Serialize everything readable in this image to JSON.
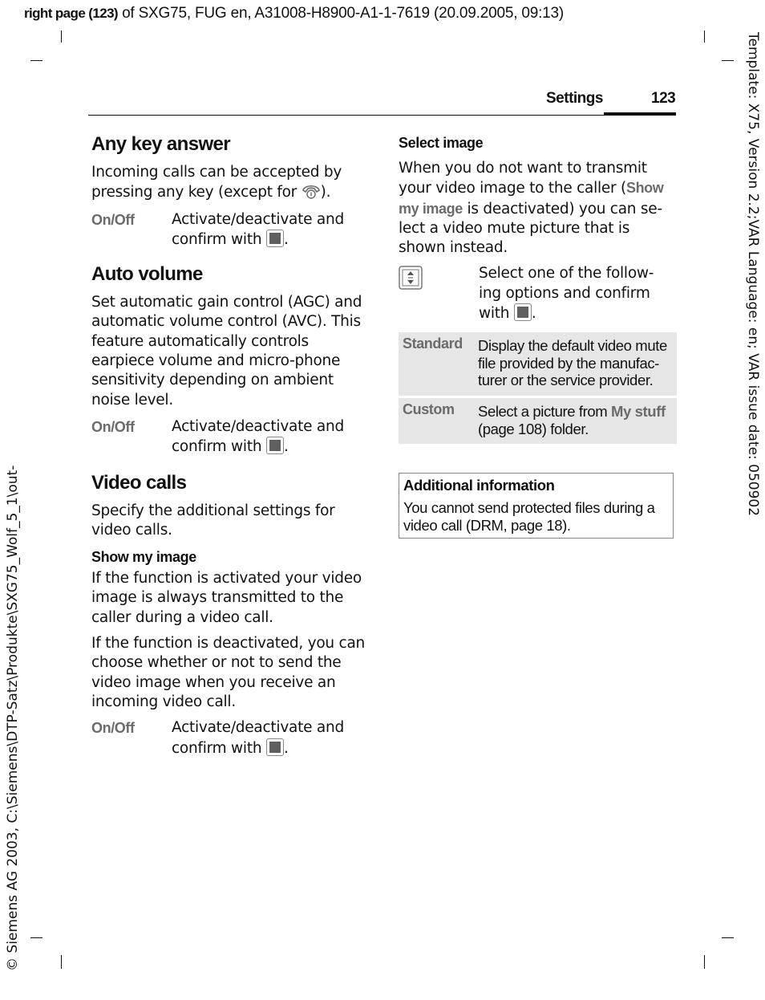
{
  "top_line": {
    "bold_part": "right page (123)",
    "rest": " of SXG75, FUG en, A31008-H8900-A1-1-7619 (20.09.2005, 09:13)"
  },
  "side_right": "Template: X75, Version 2.2;VAR Language: en; VAR issue date: 050902",
  "side_left": "© Siemens AG 2003, C:\\Siemens\\DTP-Satz\\Produkte\\SXG75_Wolf_5_1\\out-",
  "header": {
    "section": "Settings",
    "page_number": "123"
  },
  "left_column": {
    "any_key": {
      "title": "Any key answer",
      "text_before_icon": "Incoming calls can be accepted by pressing any key (except for ",
      "icon": "end-call-key-icon",
      "text_after_icon": ").",
      "option_key": "On/Off",
      "option_text": "Activate/deactivate and confirm with ",
      "option_icon": "ok-key-icon",
      "option_end": "."
    },
    "auto_volume": {
      "title": "Auto volume",
      "text": "Set automatic gain control (AGC) and automatic volume control (AVC). This feature automatically controls earpiece volume and micro-phone sensitivity depending on ambient noise level.",
      "option_key": "On/Off",
      "option_text": "Activate/deactivate and confirm with ",
      "option_icon": "ok-key-icon",
      "option_end": "."
    },
    "video_calls": {
      "title": "Video calls",
      "intro": "Specify the additional settings for video calls.",
      "show_my_image": {
        "subtitle": "Show my image",
        "para1": "If the function is activated your video image is always transmitted to the caller during a video call.",
        "para2": "If the function is deactivated, you can choose whether or not to send the video image when you receive an incoming video call.",
        "option_key": "On/Off",
        "option_text": "Activate/deactivate and confirm with ",
        "option_icon": "ok-key-icon",
        "option_end": "."
      }
    }
  },
  "right_column": {
    "select_image": {
      "subtitle": "Select image",
      "text_1": "When you do not want to transmit your video image to the caller (",
      "highlight": "Show my image",
      "text_2": " is deactivated) you can se-lect a video mute picture that is shown instead.",
      "nav_icon": "navigation-key-icon",
      "nav_text": "Select one of the follow-ing options and confirm with ",
      "nav_end": "."
    },
    "options": [
      {
        "key": "Standard",
        "text": "Display the default video mute file provided by the manufac-turer or the service provider."
      },
      {
        "key": "Custom",
        "text_1": "Select a picture from ",
        "highlight": "My stuff",
        "text_2": " (page 108) folder."
      }
    ],
    "info_box": {
      "title": "Additional information",
      "text": "You cannot send protected files during a video call (DRM, page 18)."
    }
  },
  "colors": {
    "option_gray": "#6b6b6b",
    "table_bg": "#e6e6e6",
    "ok_key_fill": "#5f5f5f"
  }
}
